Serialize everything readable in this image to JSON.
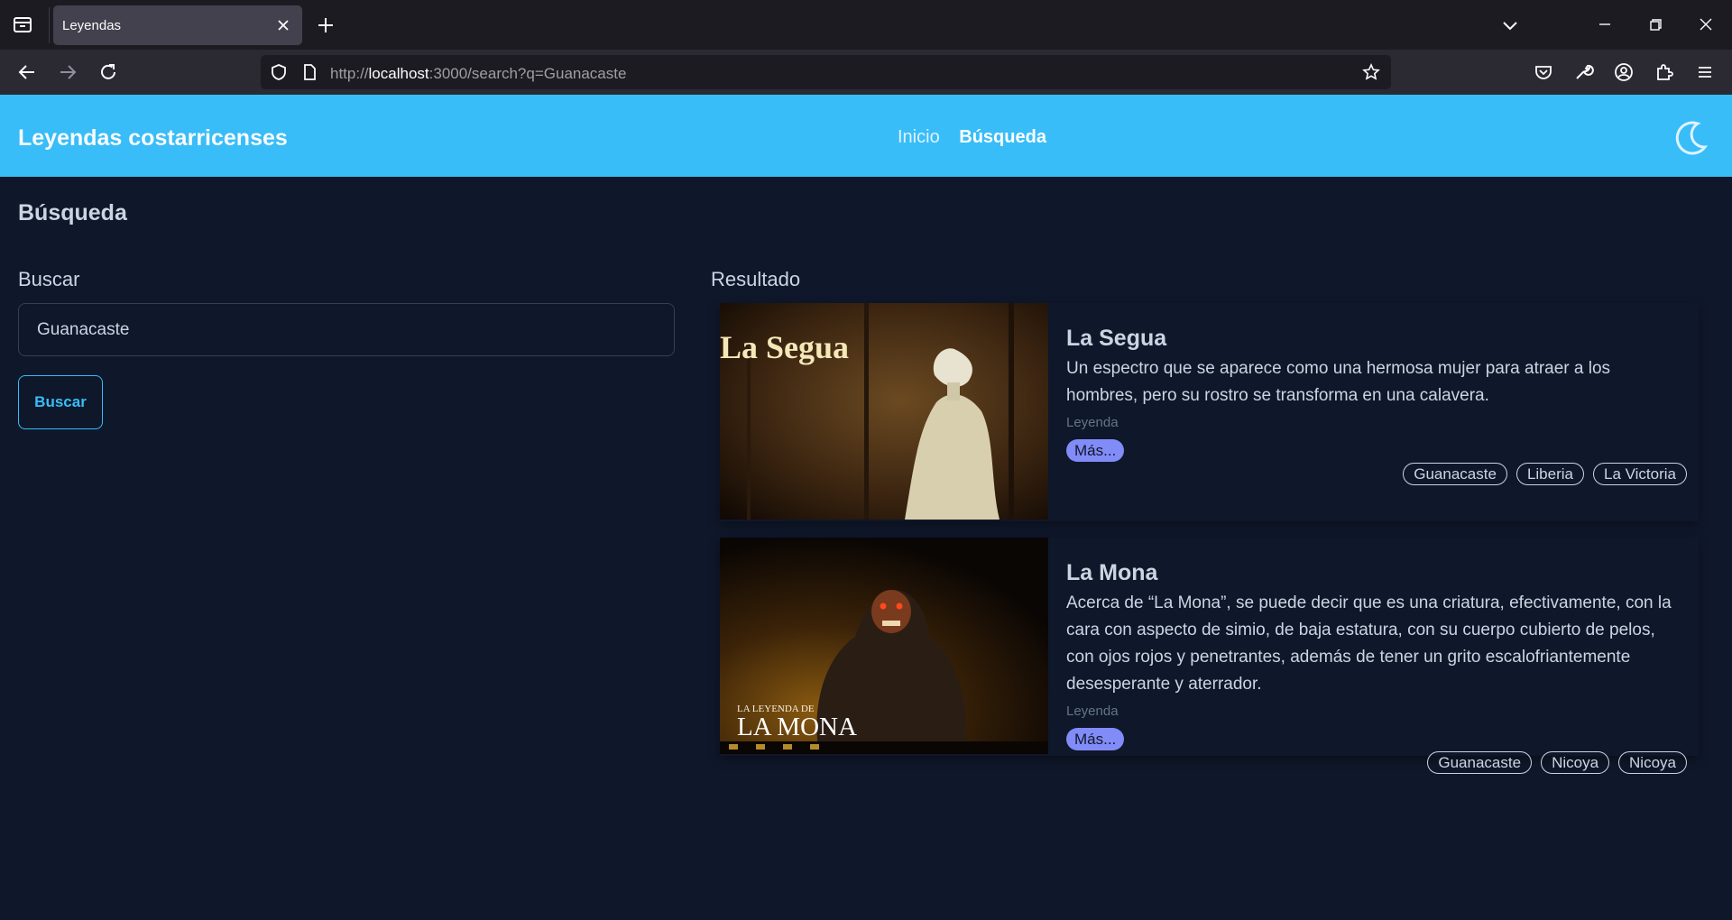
{
  "browser": {
    "tab_title": "Leyendas",
    "url_prefix": "http://",
    "url_host": "localhost",
    "url_rest": ":3000/search?q=Guanacaste"
  },
  "app": {
    "brand": "Leyendas costarricenses",
    "nav": {
      "home": "Inicio",
      "search": "Búsqueda"
    },
    "accent": "#38bdf8",
    "background": "#0f172a"
  },
  "page": {
    "title": "Búsqueda",
    "search": {
      "heading": "Buscar",
      "value": "Guanacaste",
      "button": "Buscar"
    },
    "results_heading": "Resultado",
    "results": [
      {
        "title": "La Segua",
        "image_caption": "La Segua",
        "description": "Un espectro que se aparece como una hermosa mujer para atraer a los hombres, pero su rostro se transforma en una calavera.",
        "type": "Leyenda",
        "more": "Más...",
        "tags": [
          "Guanacaste",
          "Liberia",
          "La Victoria"
        ]
      },
      {
        "title": "La Mona",
        "image_caption_small": "LA LEYENDA DE",
        "image_caption": "LA MONA",
        "description": "Acerca de “La Mona”, se puede decir que es una criatura, efectivamente, con la cara con aspecto de simio, de baja estatura, con su cuerpo cubierto de pelos, con ojos rojos y penetrantes, además de tener un grito escalofriantemente desesperante y aterrador.",
        "type": "Leyenda",
        "more": "Más...",
        "tags": [
          "Guanacaste",
          "Nicoya",
          "Nicoya"
        ]
      }
    ]
  }
}
